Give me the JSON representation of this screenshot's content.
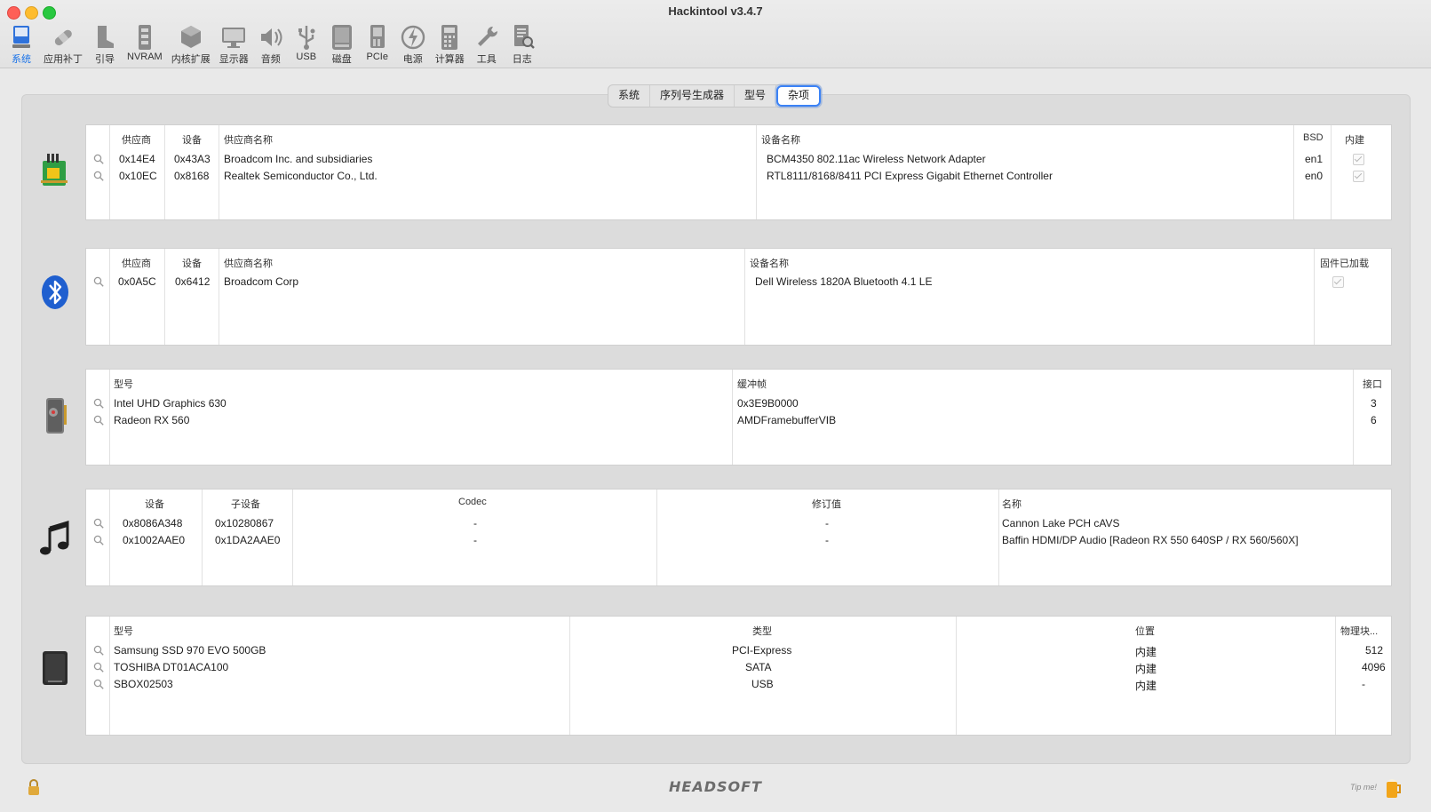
{
  "window": {
    "title": "Hackintool v3.4.7"
  },
  "toolbar": {
    "items": [
      {
        "label": "系统",
        "icon": "system-icon",
        "active": true
      },
      {
        "label": "应用补丁",
        "icon": "bandage-icon"
      },
      {
        "label": "引导",
        "icon": "boot-icon"
      },
      {
        "label": "NVRAM",
        "icon": "nvram-icon"
      },
      {
        "label": "内核扩展",
        "icon": "kext-icon"
      },
      {
        "label": "显示器",
        "icon": "monitor-icon"
      },
      {
        "label": "音频",
        "icon": "speaker-icon"
      },
      {
        "label": "USB",
        "icon": "usb-icon"
      },
      {
        "label": "磁盘",
        "icon": "disk-icon"
      },
      {
        "label": "PCIe",
        "icon": "pcie-icon"
      },
      {
        "label": "电源",
        "icon": "power-icon"
      },
      {
        "label": "计算器",
        "icon": "calculator-icon"
      },
      {
        "label": "工具",
        "icon": "wrench-icon"
      },
      {
        "label": "日志",
        "icon": "log-icon"
      }
    ]
  },
  "tabs": {
    "items": [
      "系统",
      "序列号生成器",
      "型号",
      "杂项"
    ],
    "active": "杂项"
  },
  "network": {
    "headers": [
      "供应商",
      "设备",
      "供应商名称",
      "设备名称",
      "BSD",
      "内建"
    ],
    "rows": [
      {
        "vendor": "0x14E4",
        "device": "0x43A3",
        "vendor_name": "Broadcom Inc. and subsidiaries",
        "device_name": "BCM4350 802.11ac Wireless Network Adapter",
        "bsd": "en1",
        "builtin": true
      },
      {
        "vendor": "0x10EC",
        "device": "0x8168",
        "vendor_name": "Realtek Semiconductor Co., Ltd.",
        "device_name": "RTL8111/8168/8411 PCI Express Gigabit Ethernet Controller",
        "bsd": "en0",
        "builtin": true
      }
    ]
  },
  "bluetooth": {
    "headers": [
      "供应商",
      "设备",
      "供应商名称",
      "设备名称",
      "固件已加载"
    ],
    "rows": [
      {
        "vendor": "0x0A5C",
        "device": "0x6412",
        "vendor_name": "Broadcom Corp",
        "device_name": "Dell Wireless 1820A Bluetooth 4.1 LE",
        "firmware_loaded": true
      }
    ]
  },
  "graphics": {
    "headers": [
      "型号",
      "缓冲帧",
      "接口"
    ],
    "rows": [
      {
        "model": "Intel UHD Graphics 630",
        "framebuffer": "0x3E9B0000",
        "ports": "3"
      },
      {
        "model": "Radeon RX 560",
        "framebuffer": "AMDFramebufferVIB",
        "ports": "6"
      }
    ]
  },
  "audio": {
    "headers": [
      "设备",
      "子设备",
      "Codec",
      "修订值",
      "名称"
    ],
    "rows": [
      {
        "device": "0x8086A348",
        "subdevice": "0x10280867",
        "codec": "-",
        "revision": "-",
        "name": "Cannon Lake PCH cAVS"
      },
      {
        "device": "0x1002AAE0",
        "subdevice": "0x1DA2AAE0",
        "codec": "-",
        "revision": "-",
        "name": "Baffin HDMI/DP Audio [Radeon RX 550 640SP / RX 560/560X]"
      }
    ]
  },
  "storage": {
    "headers": [
      "型号",
      "类型",
      "位置",
      "物理块..."
    ],
    "rows": [
      {
        "model": "Samsung SSD 970 EVO 500GB",
        "type": "PCI-Express",
        "location": "内建",
        "block": "512"
      },
      {
        "model": "TOSHIBA DT01ACA100",
        "type": "SATA",
        "location": "内建",
        "block": "4096"
      },
      {
        "model": "SBOX02503",
        "type": "USB",
        "location": "内建",
        "block": "-"
      }
    ]
  },
  "footer": {
    "brand": "HEADSOFT",
    "tip": "Tip me!"
  },
  "colors": {
    "accent": "#2f72db",
    "focus_ring": "#3b82f6"
  }
}
